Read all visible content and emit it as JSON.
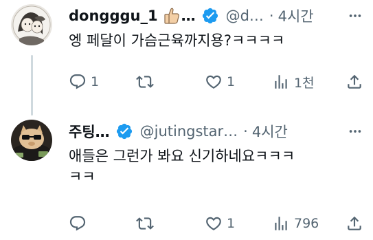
{
  "tweets": [
    {
      "display_name": "dongggu_1",
      "name_ellipsis": "…",
      "emoji": "thumbs-up",
      "handle": "@d…",
      "dot": "·",
      "time": "4시간",
      "text": "엥 페달이 가슴근육까지용?ㅋㅋㅋㅋ",
      "replies": "1",
      "retweets": "",
      "likes": "1",
      "views": "1천"
    },
    {
      "display_name": "주팅…",
      "handle": "@jutingstar…",
      "dot": "·",
      "time": "4시간",
      "text": "애들은 그런가 봐요 신기하네요ㅋㅋㅋ\nㅋㅋ",
      "replies": "",
      "retweets": "",
      "likes": "1",
      "views": "796"
    }
  ],
  "colors": {
    "text": "#0f1419",
    "muted": "#536471",
    "verified": "#1d9bf0",
    "thread_line": "#cfd9de"
  },
  "icons": {
    "reply": "reply-icon",
    "retweet": "retweet-icon",
    "like": "heart-icon",
    "views": "views-icon",
    "share": "share-icon",
    "more": "more-icon",
    "verified": "verified-badge-icon"
  }
}
